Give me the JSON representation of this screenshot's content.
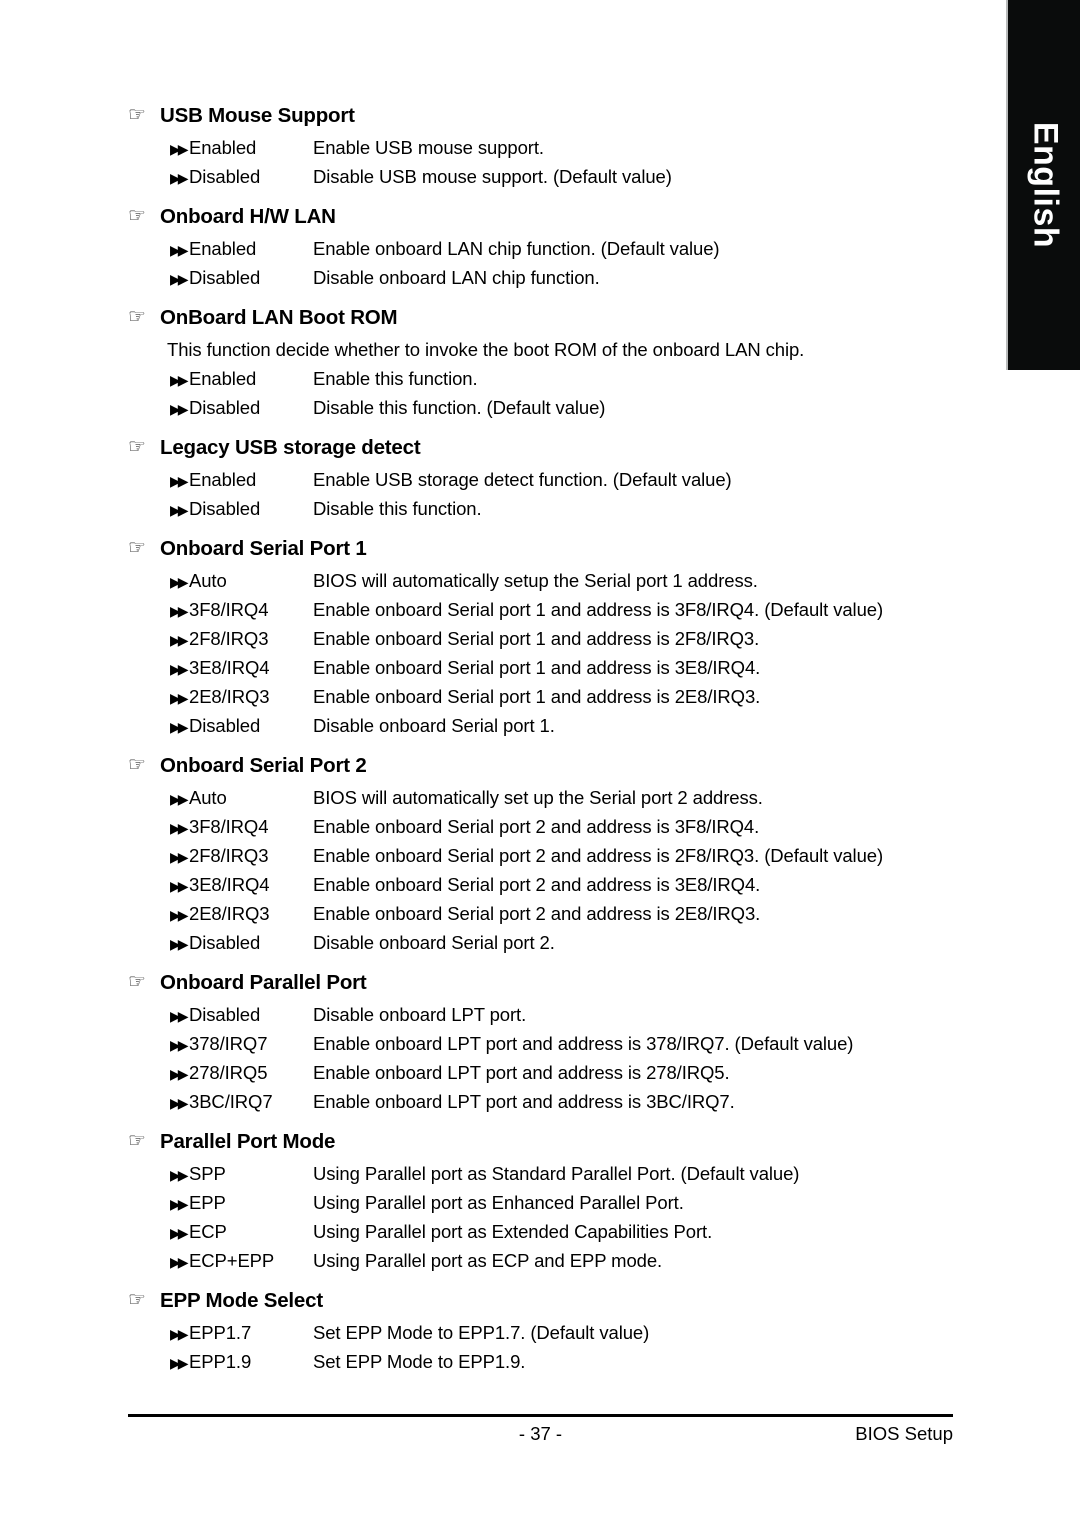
{
  "language_tab": {
    "label": "English"
  },
  "icons": {
    "heading_bullet": "☞",
    "option_bullet": "▶▶"
  },
  "footer": {
    "page_number": "- 37 -",
    "label": "BIOS Setup"
  },
  "sections": [
    {
      "title": "USB Mouse Support",
      "note": null,
      "options": [
        {
          "label": "Enabled",
          "desc": "Enable USB mouse support."
        },
        {
          "label": "Disabled",
          "desc": "Disable USB mouse support. (Default value)"
        }
      ]
    },
    {
      "title": "Onboard H/W LAN",
      "note": null,
      "options": [
        {
          "label": "Enabled",
          "desc": "Enable onboard LAN chip function. (Default value)"
        },
        {
          "label": "Disabled",
          "desc": "Disable onboard LAN chip function."
        }
      ]
    },
    {
      "title": "OnBoard LAN Boot ROM",
      "note": "This function decide whether to invoke the boot ROM of the onboard LAN chip.",
      "options": [
        {
          "label": "Enabled",
          "desc": "Enable this function."
        },
        {
          "label": "Disabled",
          "desc": "Disable this function. (Default value)"
        }
      ]
    },
    {
      "title": "Legacy USB storage detect",
      "note": null,
      "options": [
        {
          "label": "Enabled",
          "desc": "Enable USB storage detect function. (Default value)"
        },
        {
          "label": "Disabled",
          "desc": "Disable this function."
        }
      ]
    },
    {
      "title": "Onboard Serial Port 1",
      "note": null,
      "options": [
        {
          "label": "Auto",
          "desc": "BIOS will automatically setup the Serial port 1 address."
        },
        {
          "label": "3F8/IRQ4",
          "desc": "Enable onboard Serial port 1 and address is 3F8/IRQ4. (Default value)"
        },
        {
          "label": "2F8/IRQ3",
          "desc": "Enable onboard Serial port 1 and address is 2F8/IRQ3."
        },
        {
          "label": "3E8/IRQ4",
          "desc": "Enable onboard Serial port 1 and address is 3E8/IRQ4."
        },
        {
          "label": "2E8/IRQ3",
          "desc": "Enable onboard Serial port 1 and address is 2E8/IRQ3."
        },
        {
          "label": "Disabled",
          "desc": "Disable onboard Serial port 1."
        }
      ]
    },
    {
      "title": "Onboard Serial Port 2",
      "note": null,
      "options": [
        {
          "label": "Auto",
          "desc": "BIOS will automatically set up the  Serial port 2 address."
        },
        {
          "label": "3F8/IRQ4",
          "desc": "Enable onboard Serial port 2 and address is 3F8/IRQ4."
        },
        {
          "label": "2F8/IRQ3",
          "desc": "Enable onboard Serial port 2 and address is 2F8/IRQ3. (Default value)"
        },
        {
          "label": "3E8/IRQ4",
          "desc": "Enable onboard Serial port 2 and address is 3E8/IRQ4."
        },
        {
          "label": "2E8/IRQ3",
          "desc": "Enable onboard Serial port 2 and address is 2E8/IRQ3."
        },
        {
          "label": "Disabled",
          "desc": "Disable onboard Serial port 2."
        }
      ]
    },
    {
      "title": "Onboard Parallel Port",
      "note": null,
      "options": [
        {
          "label": "Disabled",
          "desc": "Disable onboard LPT port."
        },
        {
          "label": "378/IRQ7",
          "desc": "Enable onboard LPT port and address is 378/IRQ7. (Default value)"
        },
        {
          "label": "278/IRQ5",
          "desc": "Enable onboard LPT port and address is 278/IRQ5."
        },
        {
          "label": "3BC/IRQ7",
          "desc": "Enable onboard LPT port and address is 3BC/IRQ7."
        }
      ]
    },
    {
      "title": "Parallel Port Mode",
      "note": null,
      "options": [
        {
          "label": "SPP",
          "desc": "Using Parallel port as Standard Parallel Port. (Default value)"
        },
        {
          "label": "EPP",
          "desc": "Using Parallel port as Enhanced Parallel Port."
        },
        {
          "label": "ECP",
          "desc": "Using Parallel port as Extended Capabilities Port."
        },
        {
          "label": "ECP+EPP",
          "desc": "Using Parallel port as ECP and EPP mode."
        }
      ]
    },
    {
      "title": "EPP Mode Select",
      "note": null,
      "options": [
        {
          "label": "EPP1.7",
          "desc": "Set EPP Mode to EPP1.7. (Default value)"
        },
        {
          "label": "EPP1.9",
          "desc": "Set EPP Mode to EPP1.9."
        }
      ]
    }
  ]
}
